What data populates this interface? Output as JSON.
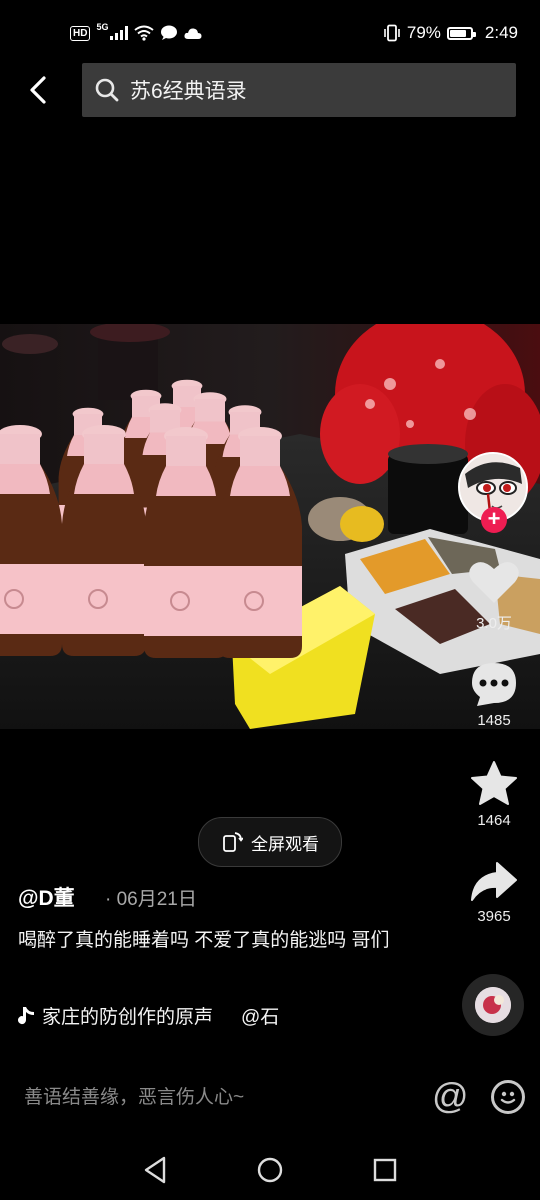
{
  "status_bar": {
    "hd": "HD",
    "network": "5G",
    "battery_percent": "79%",
    "battery_level": 0.79,
    "time": "2:49"
  },
  "header": {
    "search_query": "苏6经典语录",
    "icons": [
      "back-arrow-icon",
      "search-icon"
    ]
  },
  "video": {
    "fullscreen_label": "全屏观看"
  },
  "actions": {
    "likes": "3.0万",
    "comments": "1485",
    "favorites": "1464",
    "shares": "3965",
    "follow_symbol": "+"
  },
  "post": {
    "author": "@D董",
    "date": "· 06月21日",
    "caption": "喝醉了真的能睡着吗 不爱了真的能逃吗 哥们",
    "music_text": "家庄的防创作的原声",
    "music_mention": "@石"
  },
  "comment_bar": {
    "placeholder": "善语结善缘，恶言伤人心~",
    "at_symbol": "@"
  },
  "colors": {
    "background": "#000000",
    "follow_accent": "#ee1d52",
    "search_bg": "#3b3b3b"
  }
}
